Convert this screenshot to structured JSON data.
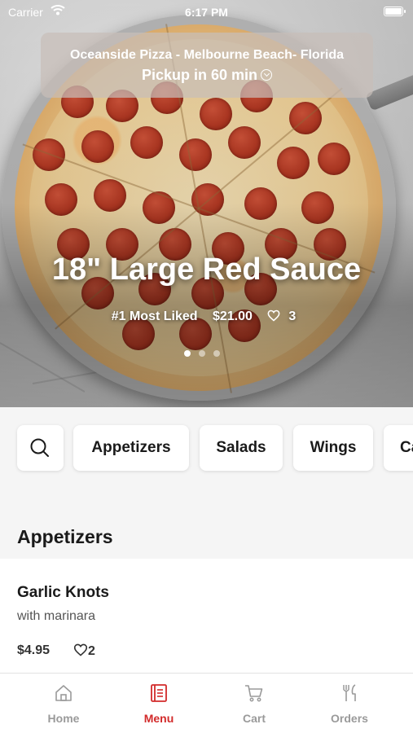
{
  "status_bar": {
    "carrier": "Carrier",
    "time": "6:17 PM"
  },
  "store": {
    "name": "Oceanside Pizza - Melbourne Beach- Florida",
    "pickup": "Pickup in 60 min"
  },
  "featured": {
    "title": "18\" Large Red Sauce",
    "rank": "#1 Most Liked",
    "price": "$21.00",
    "likes": "3",
    "carousel_index": 0,
    "carousel_count": 3
  },
  "categories": [
    "Appetizers",
    "Salads",
    "Wings",
    "Ca"
  ],
  "section": {
    "title": "Appetizers",
    "items": [
      {
        "name": "Garlic Knots",
        "description": "with marinara",
        "price": "$4.95",
        "likes": "2"
      }
    ]
  },
  "tabs": [
    {
      "label": "Home",
      "icon": "home-icon",
      "active": false
    },
    {
      "label": "Menu",
      "icon": "menu-icon",
      "active": true
    },
    {
      "label": "Cart",
      "icon": "cart-icon",
      "active": false
    },
    {
      "label": "Orders",
      "icon": "fork-knife-icon",
      "active": false
    }
  ],
  "colors": {
    "accent": "#d22a2a",
    "inactive": "#9a9a9a"
  }
}
